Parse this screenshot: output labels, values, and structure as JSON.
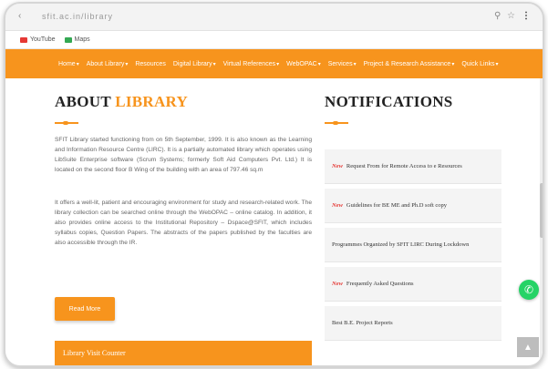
{
  "browser": {
    "url": "sfit.ac.in/library",
    "bookmarks": [
      {
        "label": "YouTube",
        "color": "#e53935"
      },
      {
        "label": "Maps",
        "color": "#34a853"
      }
    ]
  },
  "nav": {
    "items": [
      {
        "label": "Home",
        "caret": "▾"
      },
      {
        "label": "About Library",
        "caret": "▾"
      },
      {
        "label": "Resources",
        "caret": ""
      },
      {
        "label": "Digital Library",
        "caret": "▾"
      },
      {
        "label": "Virtual References",
        "caret": "▾"
      },
      {
        "label": "WebOPAC",
        "caret": "▾"
      },
      {
        "label": "Services",
        "caret": "▾"
      },
      {
        "label": "Project & Research Assistance",
        "caret": "▾"
      },
      {
        "label": "Quick Links",
        "caret": "▾"
      }
    ]
  },
  "about": {
    "title_plain": "ABOUT ",
    "title_accent": "LIBRARY",
    "para1": "SFIT Library started functioning from on 5th September, 1999. It is also known as the Learning and Information Resource Centre (LIRC). It is a partially automated library which operates using LibSuite Enterprise software (Scrum Systems; formerly Soft Aid Computers Pvt. Ltd.) It is located on the second floor B Wing of the building with an area of 797.46 sq.m",
    "para2": "It offers a well-lit, patient and encouraging environment for study and research-related work. The library collection can be searched online through the WebOPAC – online catalog. In addition, it also provides online access to the Institutional Repository – Dspace@SFIT, which includes syllabus copies, Question Papers. The abstracts of the papers published by the faculties are also accessible through the IR.",
    "read_more": "Read More",
    "counter_label": "Library Visit Counter"
  },
  "notifications": {
    "title": "NOTIFICATIONS",
    "new_label": "New",
    "items": [
      {
        "text": "Request From for Remote Access to e Resources",
        "is_new": true
      },
      {
        "text": "Guidelines for BE ME and Ph.D soft copy",
        "is_new": true
      },
      {
        "text": "Programmes Organized by SFIT LIRC During Lockdown",
        "is_new": false
      },
      {
        "text": "Frequently Asked Questions",
        "is_new": true
      },
      {
        "text": "Best B.E. Project Reports",
        "is_new": false
      }
    ]
  },
  "colors": {
    "accent": "#f7941d",
    "new_tag": "#e53935",
    "whatsapp": "#25d366"
  },
  "icons": {
    "whatsapp": "whatsapp-icon",
    "scroll_top": "arrow-up-icon",
    "star": "star-icon",
    "zoom": "zoom-icon"
  }
}
